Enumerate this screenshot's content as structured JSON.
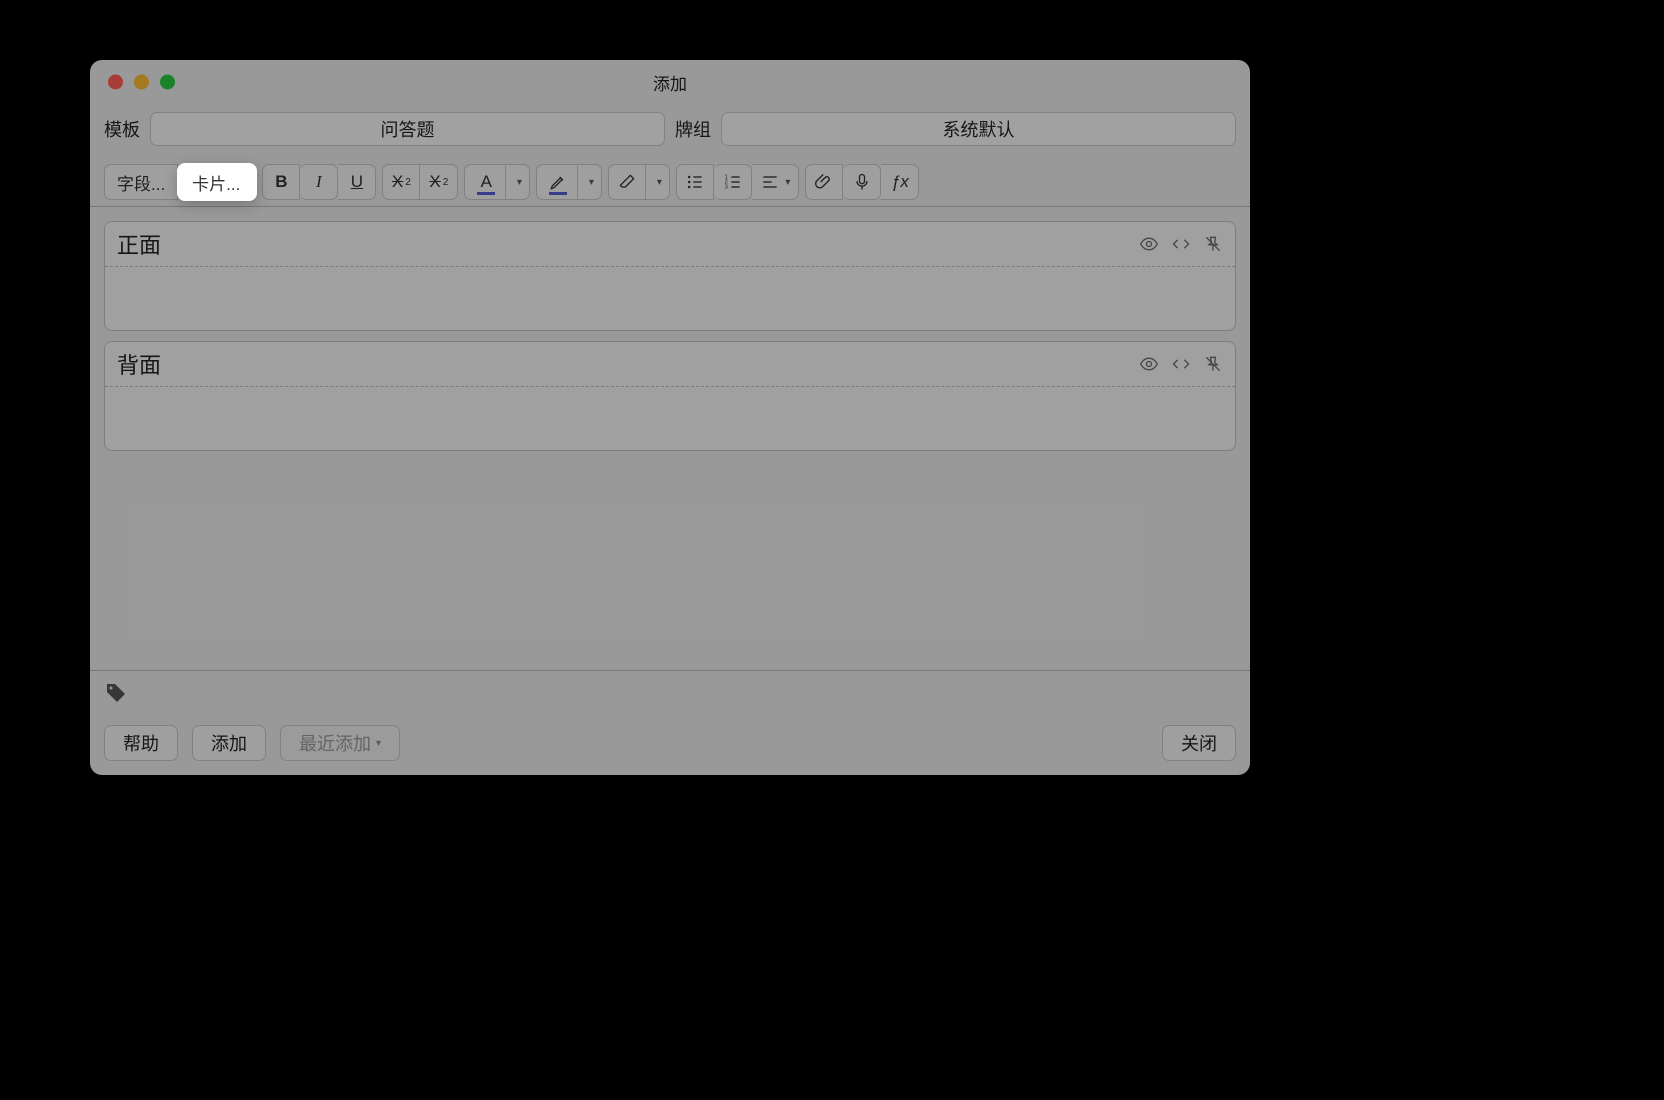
{
  "window": {
    "title": "添加"
  },
  "selectors": {
    "template_label": "模板",
    "template_value": "问答题",
    "deck_label": "牌组",
    "deck_value": "系统默认"
  },
  "toolbar": {
    "fields_label": "字段...",
    "cards_label": "卡片...",
    "bold": "B",
    "italic": "I",
    "underline": "U",
    "superscript": "X",
    "subscript": "X",
    "text_color": "A",
    "fx": "ƒx"
  },
  "fields": {
    "front_label": "正面",
    "back_label": "背面"
  },
  "footer": {
    "help": "帮助",
    "add": "添加",
    "recent_add": "最近添加",
    "close": "关闭"
  }
}
